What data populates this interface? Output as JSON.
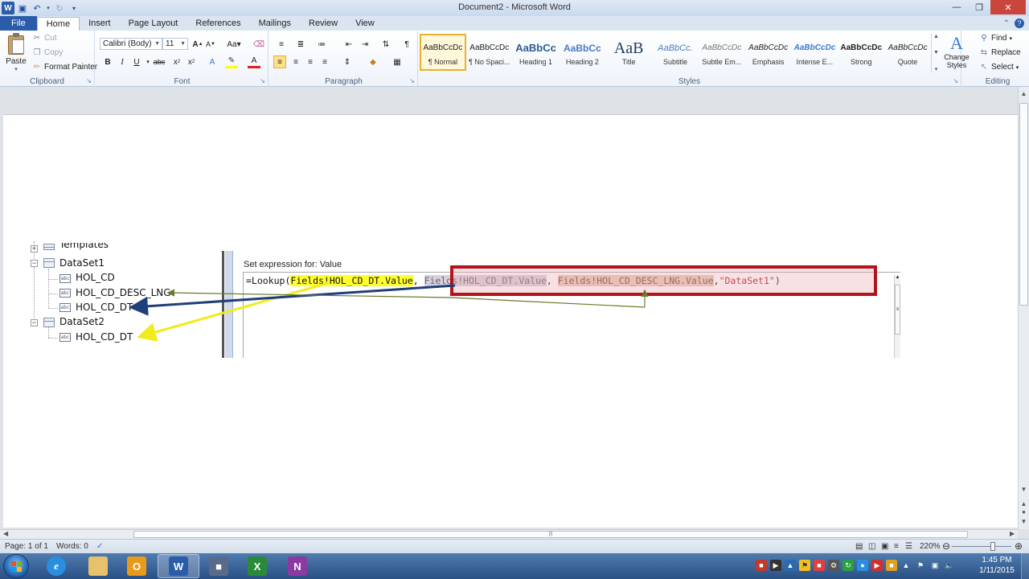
{
  "window": {
    "title": "Document2 - Microsoft Word"
  },
  "qat": {
    "icons": [
      "word-logo",
      "save-icon",
      "undo-icon",
      "redo-icon",
      "customize-icon"
    ]
  },
  "tabs": [
    "File",
    "Home",
    "Insert",
    "Page Layout",
    "References",
    "Mailings",
    "Review",
    "View"
  ],
  "ribbon": {
    "clipboard": {
      "paste": "Paste",
      "cut": "Cut",
      "copy": "Copy",
      "format_painter": "Format Painter",
      "label": "Clipboard"
    },
    "font": {
      "family": "Calibri (Body)",
      "size": "11",
      "label": "Font"
    },
    "paragraph": {
      "label": "Paragraph"
    },
    "styles": {
      "label": "Styles",
      "items": [
        {
          "sample": "AaBbCcDc",
          "name": "¶ Normal"
        },
        {
          "sample": "AaBbCcDc",
          "name": "¶ No Spaci..."
        },
        {
          "sample": "AaBbCc",
          "name": "Heading 1"
        },
        {
          "sample": "AaBbCc",
          "name": "Heading 2"
        },
        {
          "sample": "AaB",
          "name": "Title"
        },
        {
          "sample": "AaBbCc.",
          "name": "Subtitle"
        },
        {
          "sample": "AaBbCcDc",
          "name": "Subtle Em..."
        },
        {
          "sample": "AaBbCcDc",
          "name": "Emphasis"
        },
        {
          "sample": "AaBbCcDc",
          "name": "Intense E..."
        },
        {
          "sample": "AaBbCcDc",
          "name": "Strong"
        },
        {
          "sample": "AaBbCcDc",
          "name": "Quote"
        }
      ],
      "change_styles": "Change Styles"
    },
    "editing": {
      "find": "Find",
      "replace": "Replace",
      "select": "Select",
      "label": "Editing"
    }
  },
  "tree": {
    "nodes": [
      "Templates",
      "DataSet1",
      "HOL_CD",
      "HOL_CD_DESC_LNG",
      "HOL_CD_DT",
      "DataSet2",
      "HOL_CD_DT"
    ]
  },
  "expression": {
    "label": "Set expression for: Value",
    "prefix": "=Lookup(",
    "arg1": "Fields!HOL_CD_DT.Value",
    "arg2": "Fields!HOL_CD_DT.Value",
    "arg3": "Fields!HOL_CD_DESC_LNG.Value",
    "arg4": "\"DataSet1\"",
    "suffix": ")"
  },
  "statusbar": {
    "page": "Page: 1 of 1",
    "words": "Words: 0",
    "zoom": "220%"
  },
  "taskbar": {
    "apps": [
      "Internet Explorer",
      "Windows Explorer",
      "Outlook",
      "Word",
      "Visual Studio",
      "Excel",
      "OneNote"
    ],
    "time": "1:45 PM",
    "date": "1/11/2015"
  },
  "colors": {
    "accent": "#2a5caa",
    "highlight_yellow": "#ffff2e",
    "frame_red": "#b3141b",
    "arrow_blue": "#1f3f7a",
    "arrow_olive": "#6b7a2a"
  }
}
